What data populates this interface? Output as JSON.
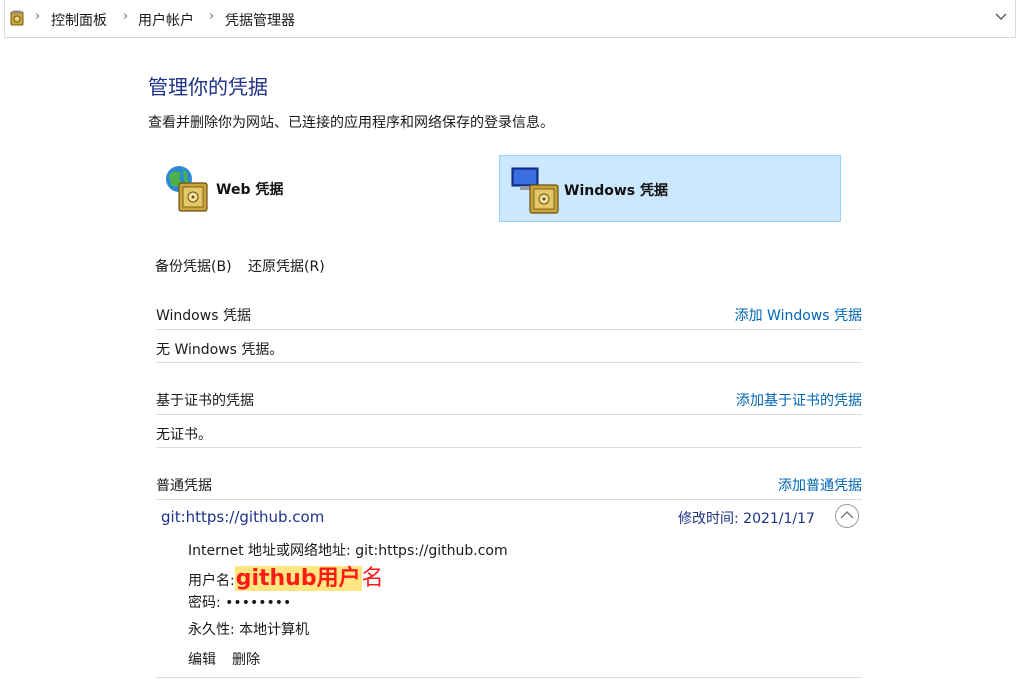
{
  "breadcrumb": [
    "控制面板",
    "用户帐户",
    "凭据管理器"
  ],
  "title": "管理你的凭据",
  "subtitle": "查看并删除你为网站、已连接的应用程序和网络保存的登录信息。",
  "tiles": {
    "web": "Web 凭据",
    "windows": "Windows 凭据"
  },
  "actions": {
    "backup": "备份凭据(B)",
    "restore": "还原凭据(R)"
  },
  "sections": {
    "windows": {
      "header": "Windows 凭据",
      "add": "添加 Windows 凭据",
      "empty": "无 Windows 凭据。"
    },
    "cert": {
      "header": "基于证书的凭据",
      "add": "添加基于证书的凭据",
      "empty": "无证书。"
    },
    "generic": {
      "header": "普通凭据",
      "add": "添加普通凭据"
    }
  },
  "credential": {
    "name": "git:https://github.com",
    "modified_label": "修改时间:",
    "modified_date": "2021/1/17",
    "address_label": "Internet 地址或网络地址:",
    "address_value": "git:https://github.com",
    "user_label": "用户名:",
    "user_value_highlight": "github用户",
    "user_value_rest": "名",
    "password_label": "密码:",
    "password_value": "••••••••",
    "persist_label": "永久性:",
    "persist_value": "本地计算机",
    "edit": "编辑",
    "delete": "删除"
  }
}
